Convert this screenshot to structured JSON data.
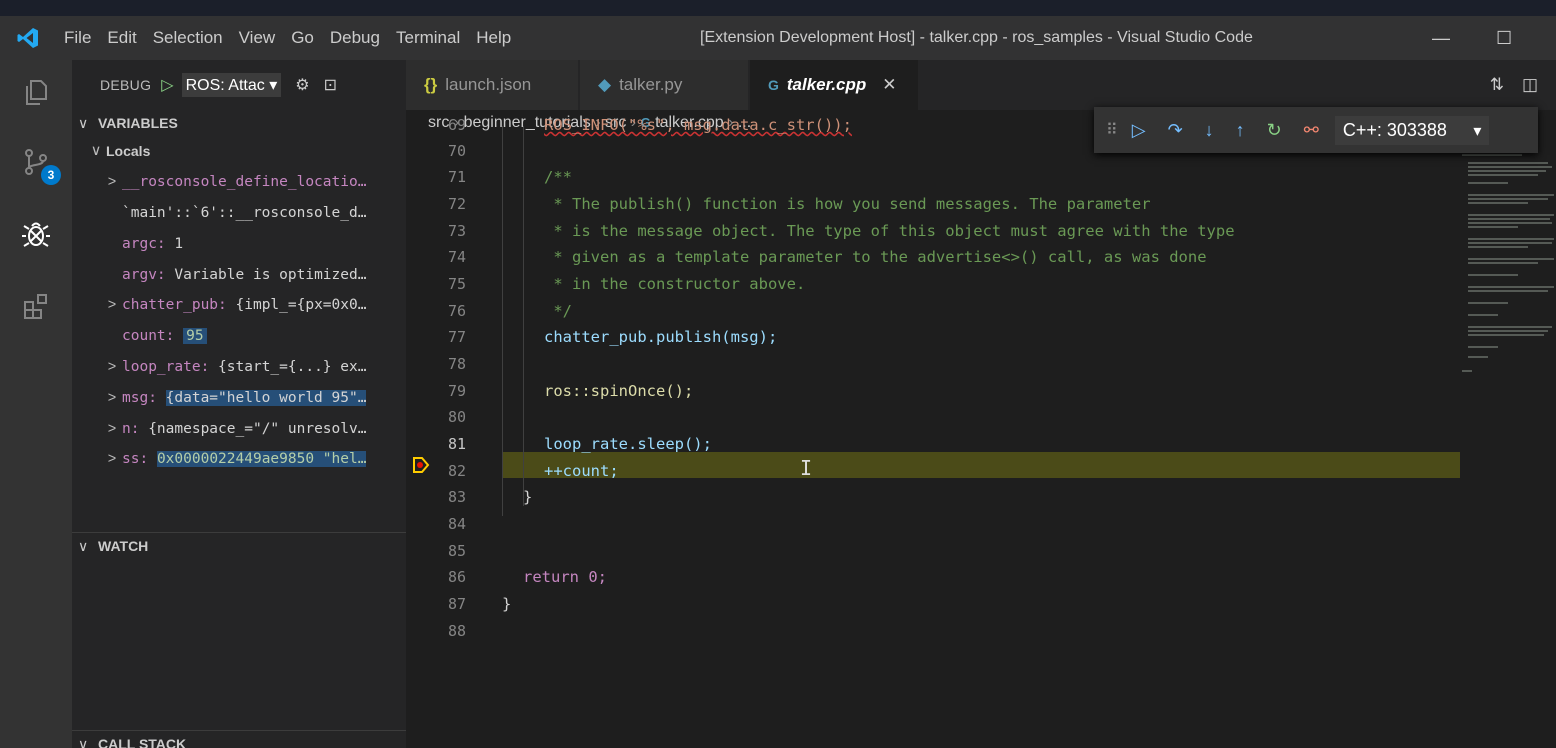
{
  "window": {
    "title": "[Extension Development Host] - talker.cpp - ros_samples - Visual Studio Code",
    "menu": [
      "File",
      "Edit",
      "Selection",
      "View",
      "Go",
      "Debug",
      "Terminal",
      "Help"
    ]
  },
  "activity": {
    "scm_badge": "3"
  },
  "debug": {
    "label": "DEBUG",
    "config": "ROS: Attac",
    "session": "C++: 303388"
  },
  "sections": {
    "variables": "VARIABLES",
    "locals": "Locals",
    "watch": "WATCH",
    "callstack": "CALL STACK"
  },
  "variables": [
    {
      "name": "__rosconsole_define_locatio…",
      "value": "",
      "expandable": true
    },
    {
      "name": "`main'::`6'::__rosconsole_d…",
      "value": "",
      "expandable": false
    },
    {
      "name": "argc:",
      "value": "1",
      "expandable": false
    },
    {
      "name": "argv:",
      "value": "Variable is optimized…",
      "expandable": false
    },
    {
      "name": "chatter_pub:",
      "value": "{impl_={px=0x0…",
      "expandable": true
    },
    {
      "name": "count:",
      "value": "95",
      "expandable": false
    },
    {
      "name": "loop_rate:",
      "value": "{start_={...} ex…",
      "expandable": true
    },
    {
      "name": "msg:",
      "value": "{data=\"hello world 95\"…",
      "expandable": true
    },
    {
      "name": "n:",
      "value": "{namespace_=\"/\" unresolv…",
      "expandable": true
    },
    {
      "name": "ss:",
      "value": "0x0000022449ae9850 \"hel…",
      "expandable": true
    }
  ],
  "tabs": [
    {
      "icon": "{}",
      "label": "launch.json"
    },
    {
      "icon": "py",
      "label": "talker.py"
    },
    {
      "icon": "C+",
      "label": "talker.cpp"
    }
  ],
  "breadcrumb": [
    "src",
    "beginner_tutorials",
    "src",
    "talker.cpp",
    "..."
  ],
  "editor": {
    "current_line": "81",
    "lines": [
      {
        "n": "69",
        "text": "ROS_INFO(\"%s\", msg.data.c_str());"
      },
      {
        "n": "70",
        "text": ""
      },
      {
        "n": "71",
        "text": "/**"
      },
      {
        "n": "72",
        "text": " * The publish() function is how you send messages. The parameter"
      },
      {
        "n": "73",
        "text": " * is the message object. The type of this object must agree with the type"
      },
      {
        "n": "74",
        "text": " * given as a template parameter to the advertise<>() call, as was done"
      },
      {
        "n": "75",
        "text": " * in the constructor above."
      },
      {
        "n": "76",
        "text": " */"
      },
      {
        "n": "77",
        "text": "chatter_pub.publish(msg);"
      },
      {
        "n": "78",
        "text": ""
      },
      {
        "n": "79",
        "text": "ros::spinOnce();"
      },
      {
        "n": "80",
        "text": ""
      },
      {
        "n": "81",
        "text": "loop_rate.sleep();"
      },
      {
        "n": "82",
        "text": "++count;"
      },
      {
        "n": "83",
        "text": "}"
      },
      {
        "n": "84",
        "text": ""
      },
      {
        "n": "85",
        "text": ""
      },
      {
        "n": "86",
        "text": "return 0;"
      },
      {
        "n": "87",
        "text": "}"
      },
      {
        "n": "88",
        "text": ""
      }
    ]
  }
}
